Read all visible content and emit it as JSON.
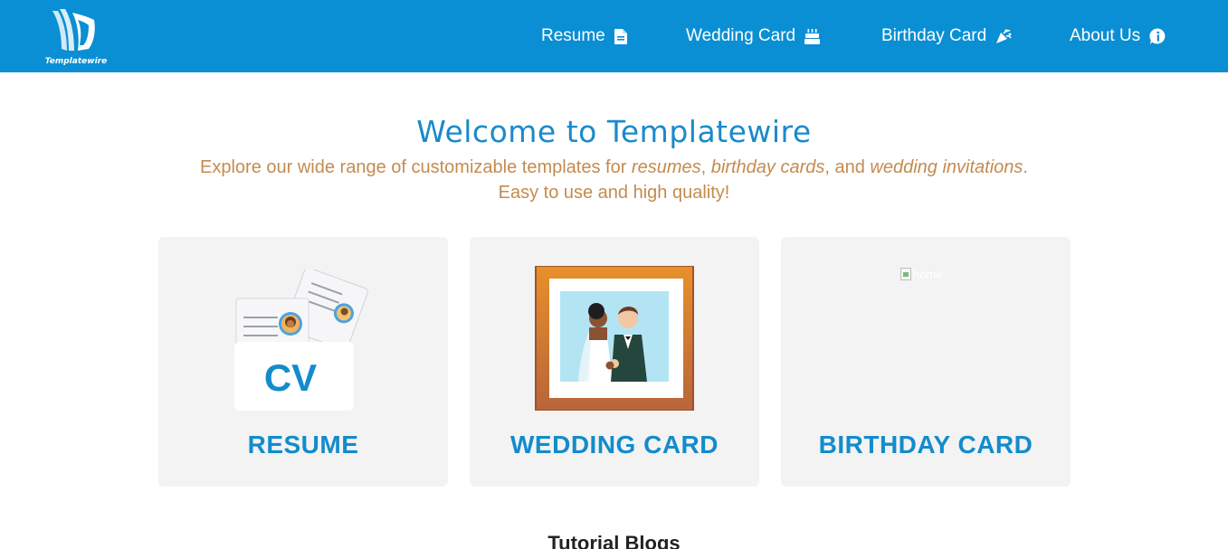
{
  "brand": {
    "name": "Templatewire",
    "color": "#0a8fd4"
  },
  "nav": {
    "items": [
      {
        "label": "Resume",
        "icon": "file-icon"
      },
      {
        "label": "Wedding Card",
        "icon": "cake-icon"
      },
      {
        "label": "Birthday Card",
        "icon": "party-horn-icon"
      },
      {
        "label": "About Us",
        "icon": "info-icon"
      }
    ]
  },
  "hero": {
    "title": "Welcome to Templatewire",
    "subtitle_parts": [
      "Explore our wide range of customizable templates for ",
      "resumes",
      ", ",
      "birthday cards",
      ", and ",
      "wedding invitations",
      ". Easy to use and high quality!"
    ]
  },
  "cards": [
    {
      "title": "RESUME",
      "image": "cv-illustration",
      "cv_text": "CV"
    },
    {
      "title": "WEDDING CARD",
      "image": "wedding-couple-frame"
    },
    {
      "title": "BIRTHDAY CARD",
      "image": "broken-image",
      "alt": "home"
    }
  ],
  "sections": {
    "tutorial_heading": "Tutorial Blogs"
  },
  "colors": {
    "title": "#1a8acb",
    "subtitle": "#c48b4f",
    "card_bg": "#f3f3f3",
    "card_title": "#128ccc"
  }
}
